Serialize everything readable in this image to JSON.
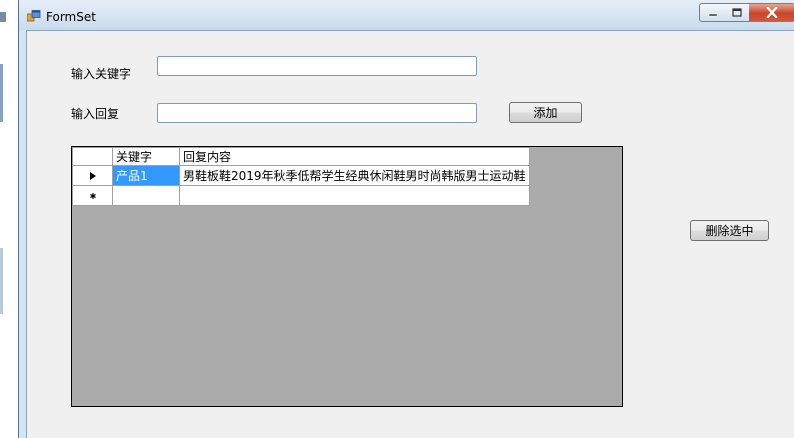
{
  "window": {
    "title": "FormSet"
  },
  "form": {
    "keyword_label": "输入关键字",
    "keyword_value": "",
    "reply_label": "输入回复",
    "reply_value": "",
    "add_button": "添加",
    "delete_button": "删除选中"
  },
  "grid": {
    "columns": [
      "关键字",
      "回复内容"
    ],
    "rows": [
      {
        "marker": "current",
        "keyword": "产品1",
        "reply": "男鞋板鞋2019年秋季低帮学生经典休闲鞋男时尚韩版男士运动鞋"
      },
      {
        "marker": "new",
        "keyword": "",
        "reply": ""
      }
    ],
    "row_marker_current": "▶",
    "row_marker_new": "*"
  },
  "icons": {
    "app": "form-app-icon",
    "minimize": "minimize-icon",
    "maximize": "maximize-icon",
    "close": "close-icon"
  },
  "colors": {
    "selection": "#3399ff",
    "grid_background": "#ababab",
    "close_button": "#c7452a"
  }
}
